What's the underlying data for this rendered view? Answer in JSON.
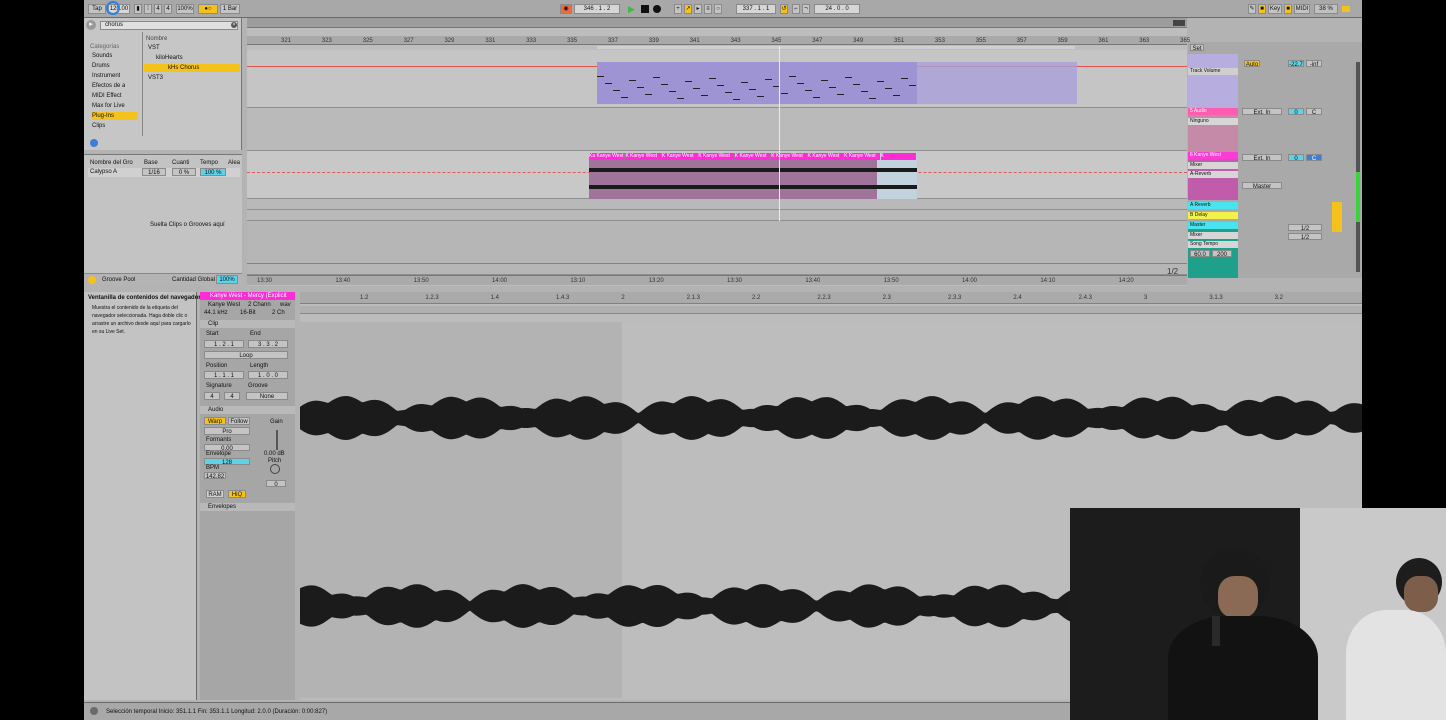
{
  "topbar": {
    "tap": "Tap",
    "tempo": "120.00",
    "signature_num": "4",
    "signature_den": "4",
    "zoom": "100%",
    "quantize": "1 Bar",
    "position": "346 . 1 . 2",
    "loop_start": "337 . 1 . 1",
    "loop_length": "24 . 0 . 0",
    "key": "Key",
    "midi": "MIDI",
    "cpu": "38 %"
  },
  "browser": {
    "search_value": "chorus",
    "categories_header": "Categorías",
    "categories": [
      "Sounds",
      "Drums",
      "Instrument",
      "Efectos de a",
      "MIDI Effect",
      "Max for Live",
      "Plug-Ins",
      "Clips"
    ],
    "name_header": "Nombre",
    "tree": [
      "VST",
      "kiloHearts",
      "kHs Chorus",
      "VST3"
    ]
  },
  "groove": {
    "headers": [
      "Nombre del Gro",
      "Base",
      "Cuanti",
      "Tempo",
      "Alea"
    ],
    "row_name": "Calypso A",
    "row_base": "1/16",
    "row_quant": "0 %",
    "row_tempo": "100 %",
    "drop_hint": "Suelta Clips o Grooves aquí",
    "footer_label": "Groove Pool",
    "footer_amount_label": "Cantidad Global",
    "footer_amount": "100%"
  },
  "arrangement": {
    "bars": [
      "321",
      "323",
      "325",
      "327",
      "329",
      "331",
      "333",
      "335",
      "337",
      "339",
      "341",
      "343",
      "345",
      "347",
      "349",
      "351",
      "353",
      "355",
      "357",
      "359",
      "361",
      "363",
      "365"
    ],
    "times": [
      "13:30",
      "13:40",
      "13:50",
      "14:00",
      "13:10",
      "13:20",
      "13:30",
      "13:40",
      "13:50",
      "14:00",
      "14:10",
      "14:20"
    ],
    "clip_names": [
      "Ka Kanye West",
      "K Kanye West",
      "K Kanye West",
      "K Kanye West",
      "K Kanye West",
      "K Kanye West",
      "K Kanye West",
      "K Kanye West",
      "K"
    ],
    "zoom_label": "1/2"
  },
  "mixer": {
    "set_label": "Set",
    "tracks": [
      {
        "name": "Track Volume",
        "color": "#b8a8e0",
        "route_in": "Auto",
        "vol": "-22.7",
        "pan": "-inf"
      },
      {
        "name": "5 Audio",
        "color": "#ff5bb0",
        "route_in": "Ext. In",
        "sub": "Ninguno",
        "vol": "0",
        "pan": "C"
      },
      {
        "name": "6 Kanye West",
        "color": "#ff3bd6",
        "route_in": "Ext. In",
        "sub": "Mixer",
        "sub2": "A-Reverb",
        "vol": "0",
        "pan": "C"
      },
      {
        "name": "A Reverb",
        "color": "#4ae3f0"
      },
      {
        "name": "B Delay",
        "color": "#f2f24a"
      },
      {
        "name": "Master",
        "color": "#4ae3f0",
        "sub": "Mixer",
        "sub2": "Song Tempo",
        "v1": "60.0",
        "v2": "200"
      }
    ],
    "sends": [
      "1/2",
      "1/2"
    ],
    "master_out": "Master"
  },
  "info": {
    "title": "Ventanilla de contenidos del navegador",
    "body": "Muestra el contenido de la etiqueta del navegador seleccionada. Haga doble clic o arrastre un archivo desde aquí para cargarlo en su Live Set."
  },
  "clip": {
    "name": "Kanye West - Mercy (Explicit",
    "file_name": "Kanye West",
    "file_channels": "2 Chann",
    "file_ext": "wav",
    "sample_rate": "44.1 kHz",
    "bit_depth": "16-Bit",
    "channels": "2 Ch",
    "clip_label": "Clip",
    "start_label": "Start",
    "end_label": "End",
    "start_val": "1 . 2 . 1",
    "end_val": "3 . 3 . 2",
    "loop_label": "Loop",
    "position_label": "Position",
    "length_label": "Length",
    "position_val": "1 . 1 . 1",
    "length_val": "1 . 0 . 0",
    "signature_label": "Signature",
    "groove_label": "Groove",
    "sig_num": "4",
    "sig_den": "4",
    "groove_val": "None",
    "audio_label": "Audio",
    "warp": "Warp",
    "follow": "Follow",
    "mode": "Pro",
    "formants_label": "Formants",
    "formants_val": "0.00",
    "envelope_label": "Envelope",
    "envelope_val": "128",
    "bpm_label": "BPM",
    "bpm_val": "142.82",
    "gain_label": "Gain",
    "gain_val": "0.00 dB",
    "pitch_label": "Pitch",
    "pitch_val": "0",
    "ram": "RAM",
    "hiq": "HiQ",
    "envelopes_label": "Envelopes"
  },
  "sample": {
    "ruler": [
      "1.2",
      "1.2.3",
      "1.4",
      "1.4.3",
      "2",
      "2.1.3",
      "2.2",
      "2.2.3",
      "2.3",
      "2.3.3",
      "2.4",
      "2.4.3",
      "3",
      "3.1.3",
      "3.2"
    ]
  },
  "status": {
    "text": "Selección temporal   Inicio: 351.1.1   Fin: 353.1.1   Longitud: 2.0.0   (Duración: 0:00:827)"
  },
  "colors": {
    "accent": "#f5c21b",
    "clip_pink": "#ff2bd6",
    "clip_purple": "#a596d0",
    "panel": "#b3b3b3"
  }
}
